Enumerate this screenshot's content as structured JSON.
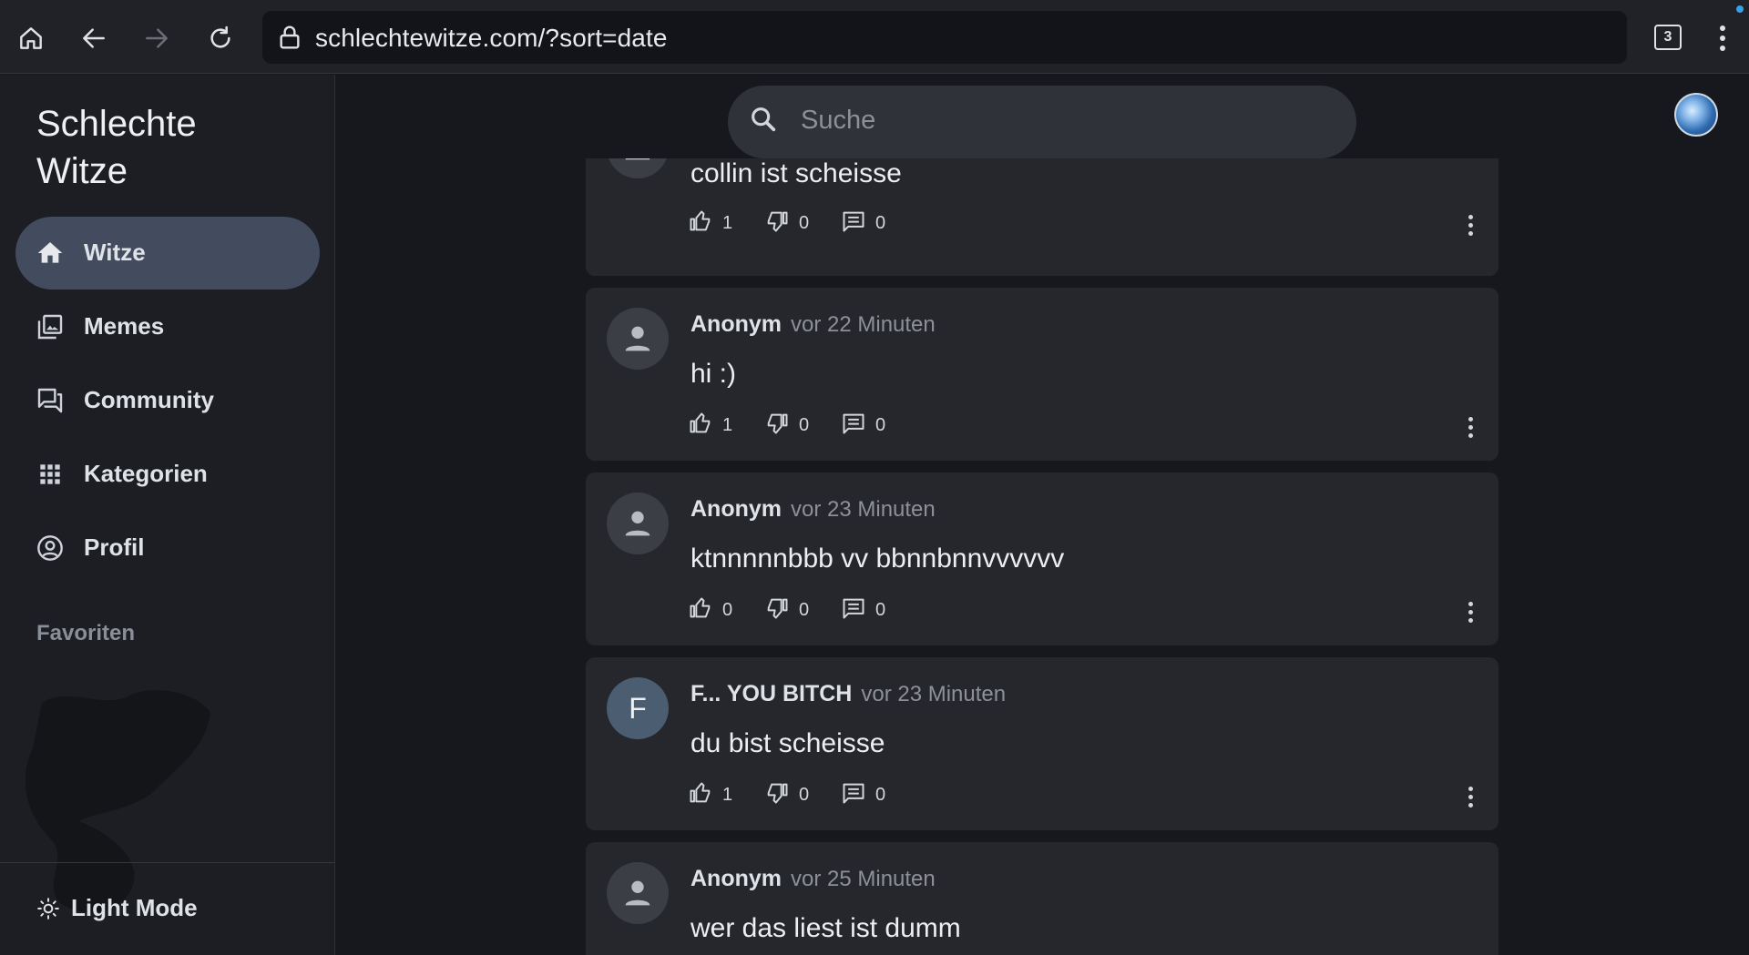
{
  "browser": {
    "url": "schlechtewitze.com/?sort=date",
    "tab_count": "3"
  },
  "sidebar": {
    "brand": "Schlechte Witze",
    "items": [
      {
        "label": "Witze",
        "icon": "home-icon",
        "active": true
      },
      {
        "label": "Memes",
        "icon": "photo-library-icon",
        "active": false
      },
      {
        "label": "Community",
        "icon": "forum-icon",
        "active": false
      },
      {
        "label": "Kategorien",
        "icon": "grid-icon",
        "active": false
      },
      {
        "label": "Profil",
        "icon": "account-circle-icon",
        "active": false
      }
    ],
    "favorites_title": "Favoriten",
    "light_mode_label": "Light Mode"
  },
  "search": {
    "placeholder": "Suche"
  },
  "posts": [
    {
      "author": "",
      "time": "",
      "text": "collin ist scheisse",
      "likes": "1",
      "dislikes": "0",
      "comments": "0"
    },
    {
      "author": "Anonym",
      "time": "vor 22 Minuten",
      "text": "hi :)",
      "likes": "1",
      "dislikes": "0",
      "comments": "0"
    },
    {
      "author": "Anonym",
      "time": "vor 23 Minuten",
      "text": "ktnnnnnbbb vv bbnnbnnvvvvvv",
      "likes": "0",
      "dislikes": "0",
      "comments": "0"
    },
    {
      "author": "F... YOU BITCH",
      "time": "vor 23 Minuten",
      "text": "du bist scheisse",
      "likes": "1",
      "dislikes": "0",
      "comments": "0",
      "avatar_letter": "F"
    },
    {
      "author": "Anonym",
      "time": "vor 25 Minuten",
      "text": "wer das liest ist dumm"
    }
  ],
  "colors": {
    "background": "#16181d",
    "sidebar": "#1c1e24",
    "card": "#25272d",
    "active_nav": "#424c5e",
    "notification": "#3aa0e8"
  }
}
